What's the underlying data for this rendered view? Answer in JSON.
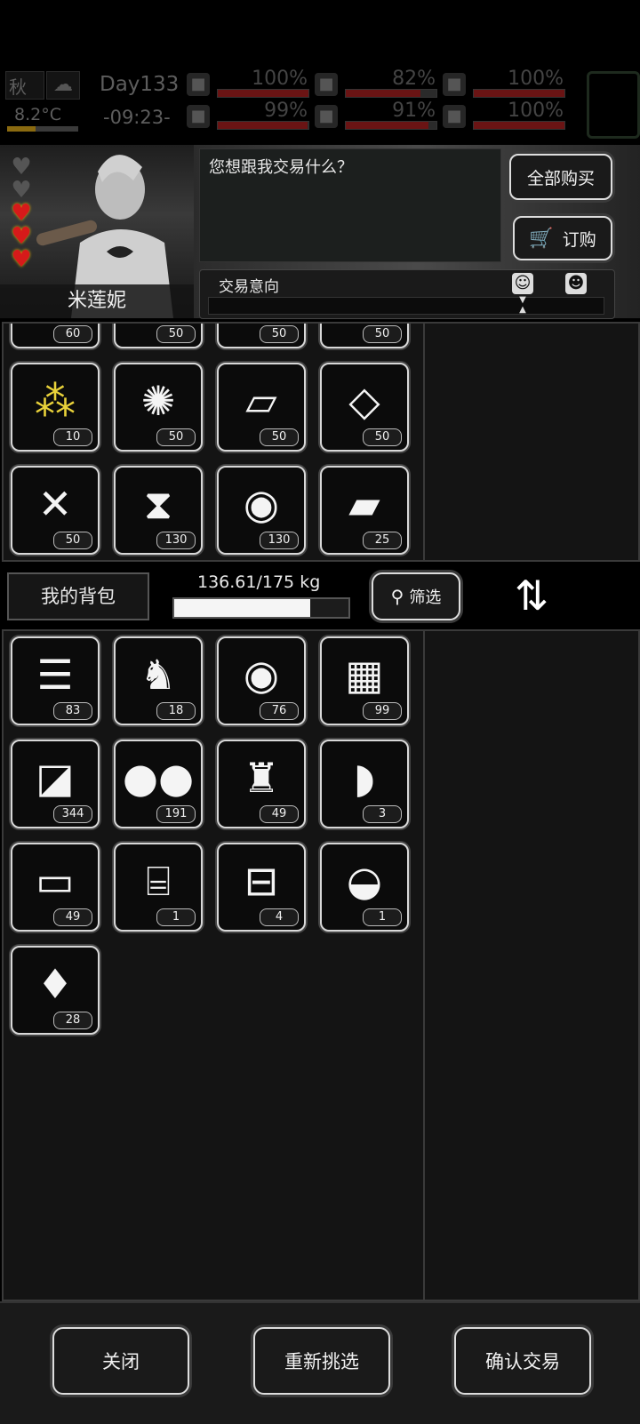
{
  "hud": {
    "season": "秋",
    "day": "Day133",
    "temperature": "8.2°C",
    "time": "-09:23-",
    "stats": [
      {
        "icon": "medkit-icon",
        "value": "100%",
        "fill": 1.0,
        "color": "#6a1414"
      },
      {
        "icon": "stomach-icon",
        "value": "82%",
        "fill": 0.82,
        "color": "#6a1414"
      },
      {
        "icon": "bladder-icon",
        "value": "100%",
        "fill": 1.0,
        "color": "#6a1414"
      },
      {
        "icon": "flask-icon",
        "value": "99%",
        "fill": 0.99,
        "color": "#6a1414"
      },
      {
        "icon": "water-drop-icon",
        "value": "91%",
        "fill": 0.91,
        "color": "#6a1414"
      },
      {
        "icon": "heart-icon",
        "value": "100%",
        "fill": 1.0,
        "color": "#6a1414"
      }
    ]
  },
  "npc": {
    "name": "米莲妮",
    "hearts_filled": 3,
    "hearts_total": 5,
    "dialog": "您想跟我交易什么？"
  },
  "buttons": {
    "buy_all": "全部购买",
    "order": "订购",
    "filter": "筛选",
    "close": "关闭",
    "reselect": "重新挑选",
    "confirm": "确认交易"
  },
  "trade": {
    "intent_label": "交易意向"
  },
  "merchant_items": [
    {
      "icon": "item-icon",
      "count": "60"
    },
    {
      "icon": "item-icon",
      "count": "50"
    },
    {
      "icon": "item-icon",
      "count": "50"
    },
    {
      "icon": "item-icon",
      "count": "50"
    },
    {
      "icon": "corn-kernels-icon",
      "count": "10"
    },
    {
      "icon": "cotton-icon",
      "count": "50"
    },
    {
      "icon": "wood-planks-icon",
      "count": "50"
    },
    {
      "icon": "scrap-metal-icon",
      "count": "50"
    },
    {
      "icon": "screws-icon",
      "count": "50"
    },
    {
      "icon": "glue-icon",
      "count": "130"
    },
    {
      "icon": "fabric-roll-icon",
      "count": "130"
    },
    {
      "icon": "leather-icon",
      "count": "25"
    }
  ],
  "inventory": {
    "label": "我的背包",
    "weight": "136.61/175 kg",
    "weight_fill": 0.7806,
    "items": [
      {
        "icon": "burger-icon",
        "count": "83"
      },
      {
        "icon": "dragon-figurine-icon",
        "count": "18"
      },
      {
        "icon": "fabric-roll-icon",
        "count": "76"
      },
      {
        "icon": "cookie-tray-icon",
        "count": "99"
      },
      {
        "icon": "cloth-icon",
        "count": "344"
      },
      {
        "icon": "nuts-icon",
        "count": "191"
      },
      {
        "icon": "bucket-icon",
        "count": "49"
      },
      {
        "icon": "bread-icon",
        "count": "3"
      },
      {
        "icon": "tofu-icon",
        "count": "49"
      },
      {
        "icon": "pickle-jar-icon",
        "count": "1"
      },
      {
        "icon": "tin-can-icon",
        "count": "4"
      },
      {
        "icon": "salad-bowl-icon",
        "count": "1"
      },
      {
        "icon": "bottle-icon",
        "count": "28"
      }
    ]
  }
}
